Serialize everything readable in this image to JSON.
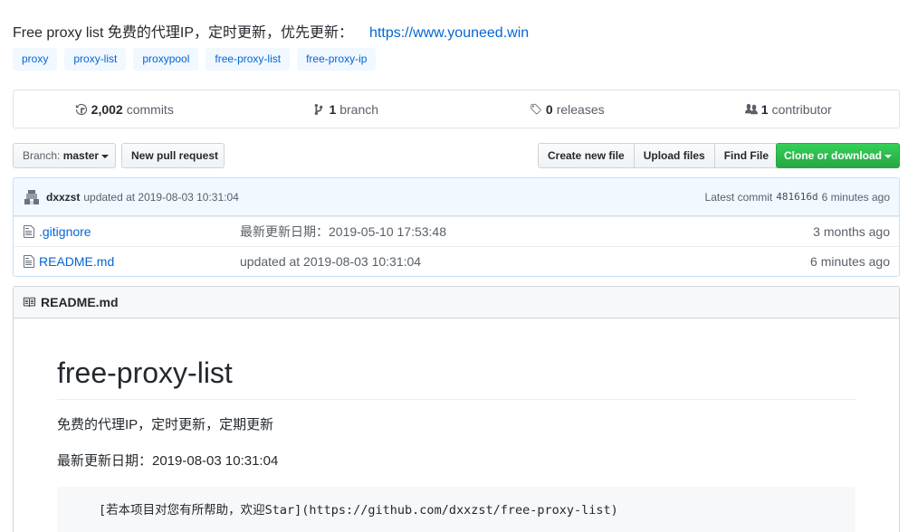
{
  "repo": {
    "description": "Free proxy list 免费的代理IP，定时更新，优先更新：",
    "homepage": "https://www.youneed.win",
    "topics": [
      "proxy",
      "proxy-list",
      "proxypool",
      "free-proxy-list",
      "free-proxy-ip"
    ]
  },
  "summary": {
    "commits_count": "2,002",
    "commits_label": "commits",
    "branch_count": "1",
    "branch_label": "branch",
    "releases_count": "0",
    "releases_label": "releases",
    "contributors_count": "1",
    "contributors_label": "contributor"
  },
  "toolbar": {
    "branch_prefix": "Branch:",
    "branch_name": "master",
    "new_pr": "New pull request",
    "create_file": "Create new file",
    "upload_files": "Upload files",
    "find_file": "Find File",
    "clone": "Clone or download"
  },
  "latest_commit": {
    "author": "dxxzst",
    "message": "updated at 2019-08-03 10:31:04",
    "label": "Latest commit",
    "sha": "481616d",
    "age": "6 minutes ago"
  },
  "files": [
    {
      "name": ".gitignore",
      "message": "最新更新日期：2019-05-10 17:53:48",
      "age": "3 months ago"
    },
    {
      "name": "README.md",
      "message": "updated at 2019-08-03 10:31:04",
      "age": "6 minutes ago"
    }
  ],
  "readme": {
    "header": "README.md",
    "title": "free-proxy-list",
    "line1": "免费的代理IP，定时更新，定期更新",
    "line2": "最新更新日期：2019-08-03 10:31:04",
    "code": "[若本项目对您有所帮助，欢迎Star](https://github.com/dxxzst/free-proxy-list)"
  },
  "colors": {
    "link": "#0366d6",
    "clone_button": "#28a745",
    "topic_bg": "#f1f8ff"
  }
}
